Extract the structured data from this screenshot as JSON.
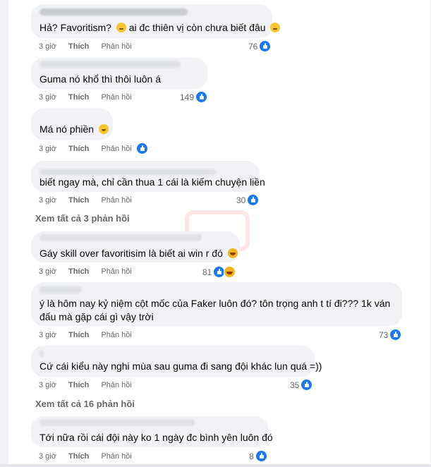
{
  "colors": {
    "bubble": "#f0f2f5",
    "accent": "#1877f2",
    "meta": "#65676b"
  },
  "comments": [
    {
      "text": "Hả? Favoritism?",
      "text_tail": "ai đc thiên vị còn chưa biết đâu",
      "emoji1": "thinking-emoji",
      "emoji2": "sad-emoji",
      "time": "3 giờ",
      "like": "Thích",
      "reply": "Phản hồi",
      "count": "76"
    },
    {
      "text": "Guma nó khổ thì thôi luôn á",
      "time": "3 giờ",
      "like": "Thích",
      "reply": "Phản hồi",
      "count": "149"
    },
    {
      "text": "Má nó phiền",
      "emoji1": "smile-emoji",
      "time": "3 giờ",
      "like": "Thích",
      "reply": "Phản hồi",
      "count": ""
    },
    {
      "text": "biết ngay mà, chỉ cần thua 1 cái là kiếm chuyện liền",
      "time": "3 giờ",
      "like": "Thích",
      "reply": "Phản hồi",
      "count": "30"
    },
    {
      "text": "Gáy skill over favoritisim là biết ai win r đó",
      "emoji1": "laughing-emoji",
      "time": "3 giờ",
      "like": "Thích",
      "reply": "Phản hồi",
      "count": "81"
    },
    {
      "text": "ý là hôm nay kỷ niệm cột mốc của Faker luôn đó? tôn trọng anh t tí đi??? 1k ván đấu mà gặp cái gì vậy trời",
      "time": "3 giờ",
      "like": "Thích",
      "reply": "Phản hồi",
      "count": "73"
    },
    {
      "text": "Cứ cái kiểu này nghi mùa sau guma đi sang đội khác lun quá =))",
      "time": "3 giờ",
      "like": "Thích",
      "reply": "Phản hồi",
      "count": "35"
    },
    {
      "text": "Tới nữa rồi cái đội này ko 1 ngày đc bình yên luôn đó",
      "time": "3 giờ",
      "like": "Thích",
      "reply": "Phản hồi",
      "count": "8"
    }
  ],
  "see_more": [
    "Xem tất cả 3 phản hồi",
    "Xem tất cả 16 phản hồi"
  ]
}
